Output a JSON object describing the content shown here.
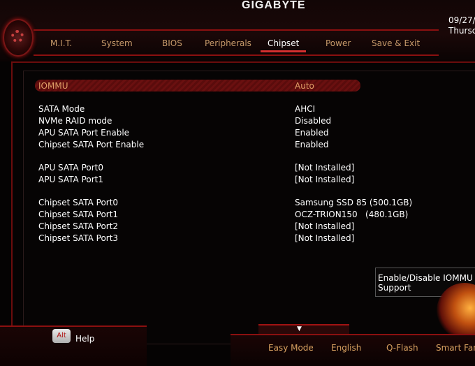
{
  "header": {
    "brand": "GIGABYTE",
    "date_line1": "09/27/",
    "date_line2": "Thursc"
  },
  "tabs": [
    {
      "label": "M.I.T."
    },
    {
      "label": "System"
    },
    {
      "label": "BIOS"
    },
    {
      "label": "Peripherals"
    },
    {
      "label": "Chipset",
      "active": true
    },
    {
      "label": "Power"
    },
    {
      "label": "Save & Exit"
    }
  ],
  "settings": [
    {
      "name": "IOMMU",
      "value": "Auto",
      "selected": true
    },
    {
      "name": "SATA Mode",
      "value": "AHCI"
    },
    {
      "name": "NVMe RAID mode",
      "value": "Disabled"
    },
    {
      "name": "APU SATA Port Enable",
      "value": "Enabled"
    },
    {
      "name": "Chipset SATA Port Enable",
      "value": "Enabled"
    },
    {
      "name": "APU SATA Port0",
      "value": "[Not Installed]"
    },
    {
      "name": "APU SATA Port1",
      "value": "[Not Installed]"
    },
    {
      "name": "Chipset SATA Port0",
      "value": "Samsung SSD 85 (500.1GB)"
    },
    {
      "name": "Chipset SATA Port1",
      "value": "OCZ-TRION150   (480.1GB)"
    },
    {
      "name": "Chipset SATA Port2",
      "value": "[Not Installed]"
    },
    {
      "name": "Chipset SATA Port3",
      "value": "[Not Installed]"
    }
  ],
  "help_panel": {
    "text": "Enable/Disable IOMMU Support"
  },
  "footer": {
    "alt_key": "Alt",
    "help_label": "Help",
    "buttons": [
      {
        "label": "Easy Mode"
      },
      {
        "label": "English"
      },
      {
        "label": "Q-Flash"
      },
      {
        "label": "Smart Fan"
      }
    ]
  },
  "colors": {
    "accent_red": "#8b1010",
    "tab_text": "#c79a6a",
    "selected_bar": "#6a1010",
    "footer_text": "#d7a060"
  }
}
